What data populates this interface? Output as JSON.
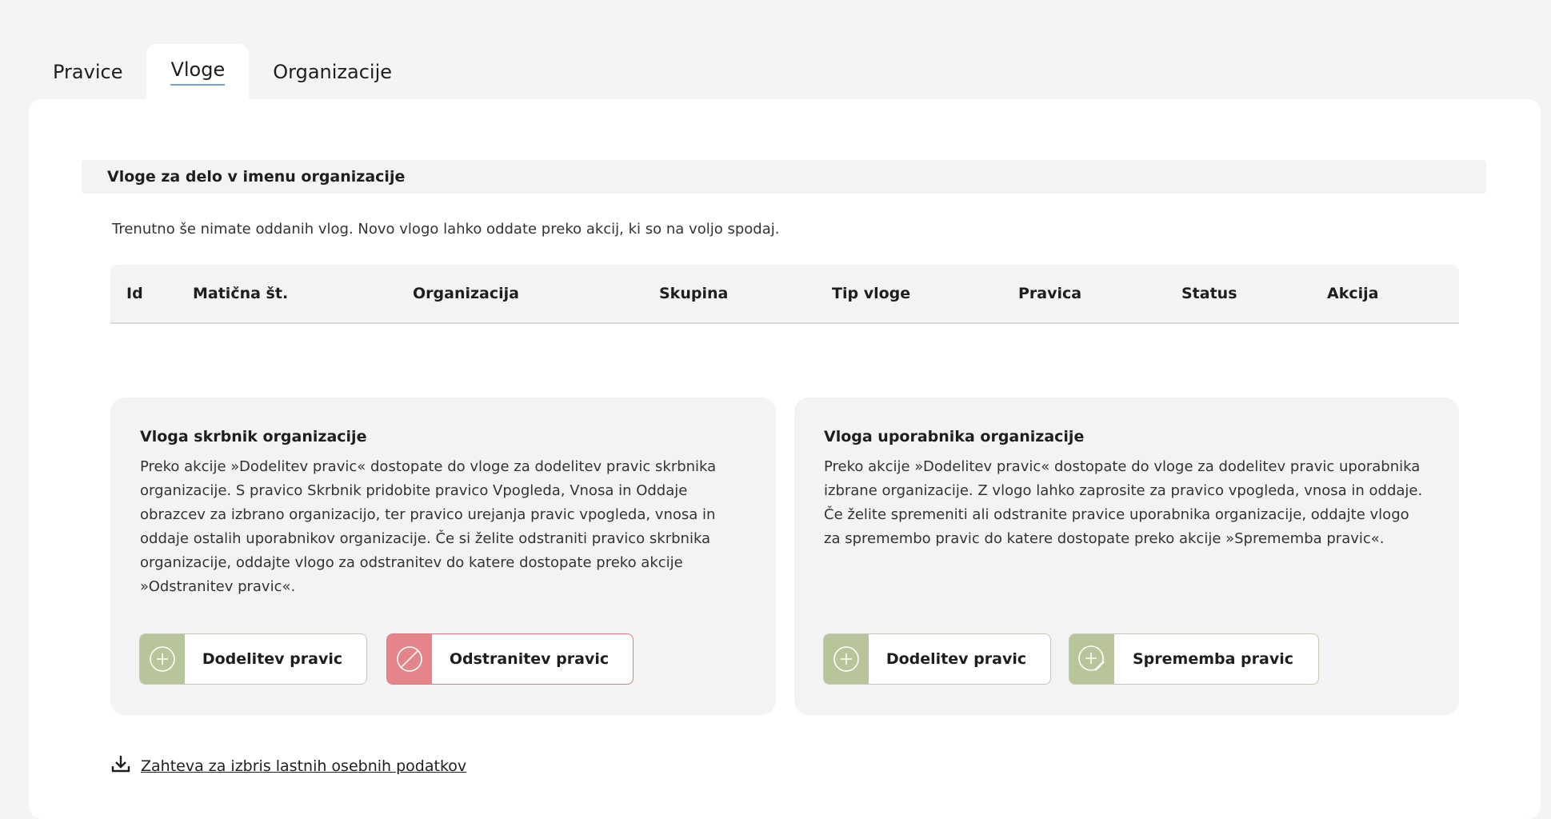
{
  "tabs": [
    {
      "label": "Pravice"
    },
    {
      "label": "Vloge"
    },
    {
      "label": "Organizacije"
    }
  ],
  "section": {
    "title": "Vloge za delo v imenu organizacije",
    "intro": "Trenutno še nimate oddanih vlog. Novo vlogo lahko oddate preko akcij, ki so na voljo spodaj."
  },
  "table": {
    "columns": [
      "Id",
      "Matična št.",
      "Organizacija",
      "Skupina",
      "Tip vloge",
      "Pravica",
      "Status",
      "Akcija"
    ]
  },
  "card_admin": {
    "title": "Vloga skrbnik organizacije",
    "text": "Preko akcije »Dodelitev pravic« dostopate do vloge za dodelitev pravic skrbnika organizacije. S pravico Skrbnik pridobite pravico Vpogleda, Vnosa in Oddaje obrazcev za izbrano organizacijo, ter pravico urejanja pravic vpogleda, vnosa in oddaje ostalih uporabnikov organizacije. Če si želite odstraniti pravico skrbnika organizacije, oddajte vlogo za odstranitev do katere dostopate preko akcije »Odstranitev pravic«.",
    "btn_assign": "Dodelitev pravic",
    "btn_remove": "Odstranitev pravic"
  },
  "card_user": {
    "title": "Vloga uporabnika organizacije",
    "text": "Preko akcije »Dodelitev pravic« dostopate do vloge za dodelitev pravic uporabnika izbrane organizacije. Z vlogo lahko zaprosite za pravico vpogleda, vnosa in oddaje. Če želite spremeniti ali odstranite pravice uporabnika organizacije, oddajte vlogo za spremembo pravic do katere dostopate preko akcije »Sprememba pravic«.",
    "btn_assign": "Dodelitev pravic",
    "btn_change": "Sprememba pravic"
  },
  "footer": {
    "link": "Zahteva za izbris lastnih osebnih podatkov"
  },
  "colors": {
    "accent_green": "#b8c49a",
    "danger_red": "#e4858b",
    "tab_underline": "#7aa3c8"
  },
  "icons": {
    "assign": "plus-circle-icon",
    "remove": "block-icon",
    "change": "edit-plus-icon",
    "download": "download-icon"
  }
}
